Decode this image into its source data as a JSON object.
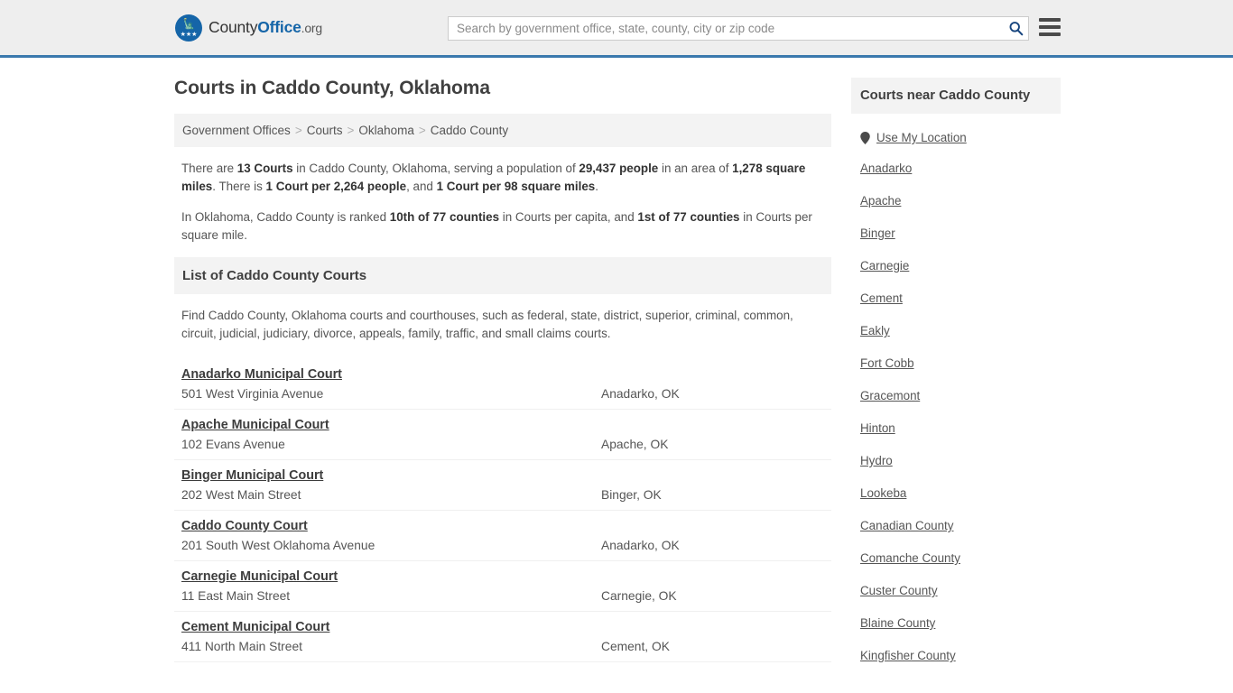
{
  "header": {
    "logo": {
      "county_text": "County",
      "office_text": "Office",
      "tld_text": ".org",
      "mark_icon": "eagle-shield-icon",
      "stars": "★★★"
    },
    "search": {
      "placeholder": "Search by government office, state, county, city or zip code",
      "value": "",
      "icon": "search-icon"
    },
    "menu_icon": "hamburger-menu-icon",
    "accent_color": "#3b79ad"
  },
  "main": {
    "title": "Courts in Caddo County, Oklahoma",
    "breadcrumb": {
      "separator": ">",
      "items": [
        {
          "label": "Government Offices"
        },
        {
          "label": "Courts"
        },
        {
          "label": "Oklahoma"
        },
        {
          "label": "Caddo County"
        }
      ]
    },
    "intro": {
      "paragraph1": [
        {
          "text": "There are ",
          "bold": false
        },
        {
          "text": "13 Courts",
          "bold": true
        },
        {
          "text": " in Caddo County, Oklahoma, serving a population of ",
          "bold": false
        },
        {
          "text": "29,437 people",
          "bold": true
        },
        {
          "text": " in an area of ",
          "bold": false
        },
        {
          "text": "1,278 square miles",
          "bold": true
        },
        {
          "text": ". There is ",
          "bold": false
        },
        {
          "text": "1 Court per 2,264 people",
          "bold": true
        },
        {
          "text": ", and ",
          "bold": false
        },
        {
          "text": "1 Court per 98 square miles",
          "bold": true
        },
        {
          "text": ".",
          "bold": false
        }
      ],
      "paragraph2": [
        {
          "text": "In Oklahoma, Caddo County is ranked ",
          "bold": false
        },
        {
          "text": "10th of 77 counties",
          "bold": true
        },
        {
          "text": " in Courts per capita, and ",
          "bold": false
        },
        {
          "text": "1st of 77 counties",
          "bold": true
        },
        {
          "text": " in Courts per square mile.",
          "bold": false
        }
      ]
    },
    "list_section": {
      "heading": "List of Caddo County Courts",
      "description": "Find Caddo County, Oklahoma courts and courthouses, such as federal, state, district, superior, criminal, common, circuit, judicial, judiciary, divorce, appeals, family, traffic, and small claims courts."
    },
    "courts": [
      {
        "name": "Anadarko Municipal Court",
        "address": "501 West Virginia Avenue",
        "city": "Anadarko, OK"
      },
      {
        "name": "Apache Municipal Court",
        "address": "102 Evans Avenue",
        "city": "Apache, OK"
      },
      {
        "name": "Binger Municipal Court",
        "address": "202 West Main Street",
        "city": "Binger, OK"
      },
      {
        "name": "Caddo County Court",
        "address": "201 South West Oklahoma Avenue",
        "city": "Anadarko, OK"
      },
      {
        "name": "Carnegie Municipal Court",
        "address": "11 East Main Street",
        "city": "Carnegie, OK"
      },
      {
        "name": "Cement Municipal Court",
        "address": "411 North Main Street",
        "city": "Cement, OK"
      }
    ]
  },
  "sidebar": {
    "heading": "Courts near Caddo County",
    "use_my_location": {
      "label": "Use My Location",
      "icon": "map-pin-icon"
    },
    "items": [
      {
        "label": "Anadarko"
      },
      {
        "label": "Apache"
      },
      {
        "label": "Binger"
      },
      {
        "label": "Carnegie"
      },
      {
        "label": "Cement"
      },
      {
        "label": "Eakly"
      },
      {
        "label": "Fort Cobb"
      },
      {
        "label": "Gracemont"
      },
      {
        "label": "Hinton"
      },
      {
        "label": "Hydro"
      },
      {
        "label": "Lookeba"
      },
      {
        "label": "Canadian County"
      },
      {
        "label": "Comanche County"
      },
      {
        "label": "Custer County"
      },
      {
        "label": "Blaine County"
      },
      {
        "label": "Kingfisher County"
      }
    ]
  }
}
